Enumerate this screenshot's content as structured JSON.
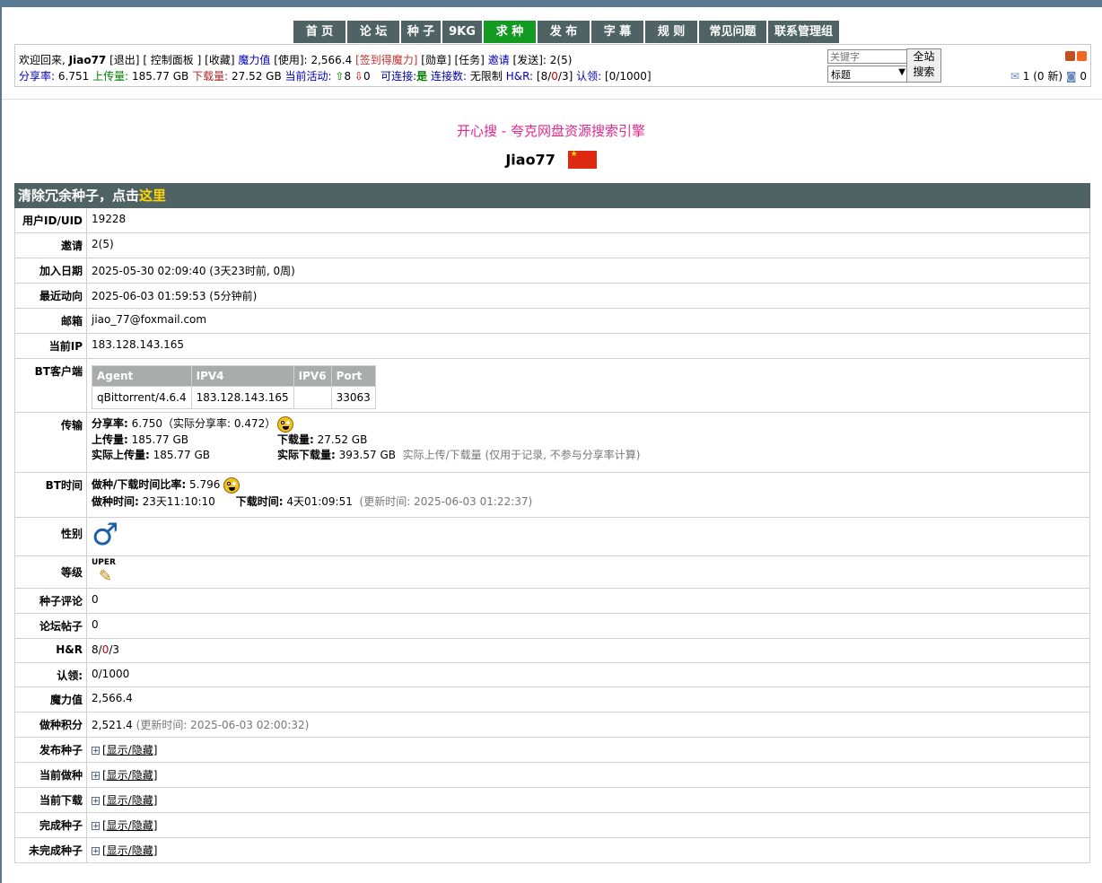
{
  "nav": [
    "首 页",
    "论 坛",
    "种 子",
    "9KG",
    "求 种",
    "发 布",
    "字 幕",
    "规 则",
    "常见问题",
    "联系管理组"
  ],
  "infobar": {
    "welcome": "欢迎回来,",
    "username": "Jiao77",
    "logout": "[退出]",
    "control_panel": "[ 控制面板 ]",
    "bookmarks": "[收藏]",
    "magic_label": "魔力值",
    "use": "[使用]:",
    "magic_value": "2,566.4",
    "checkin": "[签到得魔力]",
    "medals": "[勋章]",
    "tasks": "[任务]",
    "invite_label": "邀请",
    "invite_send": "[发送]:",
    "invite_value": "2(5)",
    "ratio_label": "分享率:",
    "ratio_value": "6.751",
    "upload_label": "上传量:",
    "upload_value": "185.77 GB",
    "download_label": "下载量:",
    "download_value": "27.52 GB",
    "activity_label": "当前活动:",
    "seeding": "8",
    "leeching": "0",
    "connectable_label": "可连接:",
    "connectable_value": "是",
    "connections_label": "连接数:",
    "connections_value": "无限制",
    "hr_label": "H&R:",
    "hr_a": "[8/",
    "hr_b": "0",
    "hr_c": "/3]",
    "claim_label": "认领:",
    "claim_value": "[0/1000]",
    "search_placeholder": "关键字",
    "search_select": "标题",
    "search_btn_1": "全站",
    "search_btn_2": "搜索",
    "messages": "1 (0 新)",
    "messages2": "0"
  },
  "promo": "开心搜 - 夸克网盘资源搜索引擎",
  "profile_name": "Jiao77",
  "banner": {
    "text": "清除冗余种子，点击",
    "link": "这里"
  },
  "rows": {
    "uid_label": "用户ID/UID",
    "uid": "19228",
    "invite_label": "邀请",
    "invite": "2(5)",
    "join_label": "加入日期",
    "join": "2025-05-30 02:09:40 (3天23时前, 0周)",
    "last_label": "最近动向",
    "last": "2025-06-03 01:59:53 (5分钟前)",
    "email_label": "邮箱",
    "email": "jiao_77@foxmail.com",
    "ip_label": "当前IP",
    "ip": "183.128.143.165",
    "bt_label": "BT客户端",
    "transfer_label": "传输",
    "bttime_label": "BT时间",
    "gender_label": "性别",
    "level_label": "等级",
    "comments_label": "种子评论",
    "comments": "0",
    "posts_label": "论坛帖子",
    "posts": "0",
    "hr_label": "H&R",
    "hr_a": "8/",
    "hr_b": "0",
    "hr_c": "/3",
    "claim_label": "认领:",
    "claim": "0/1000",
    "magic_label": "魔力值",
    "magic": "2,566.4",
    "seedpts_label": "做种积分",
    "seedpts": "2,521.4",
    "seedpts_note": "(更新时间: 2025-06-03 02:00:32)",
    "published_label": "发布种子",
    "seeding_label": "当前做种",
    "downloading_label": "当前下载",
    "completed_label": "完成种子",
    "incomplete_label": "未完成种子",
    "toggle": "[显示/隐藏]"
  },
  "bt_client": {
    "headers": [
      "Agent",
      "IPV4",
      "IPV6",
      "Port"
    ],
    "row": [
      "qBittorrent/4.6.4",
      "183.128.143.165",
      "",
      "33063"
    ]
  },
  "transfer": {
    "ratio_label": "分享率:",
    "ratio": "6.750",
    "real_ratio_label": "（实际分享率:",
    "real_ratio": "0.472）",
    "up_label": "上传量:",
    "up": "185.77 GB",
    "down_label": "下载量:",
    "down": "27.52 GB",
    "real_up_label": "实际上传量:",
    "real_up": "185.77 GB",
    "real_down_label": "实际下载量:",
    "real_down": "393.57 GB",
    "note": "实际上传/下载量 (仅用于记录, 不参与分享率计算)"
  },
  "bttime": {
    "ratio_label": "做种/下载时间比率:",
    "ratio": "5.796",
    "seed_label": "做种时间:",
    "seed": "23天11:10:10",
    "dl_label": "下载时间:",
    "dl": "4天01:09:51",
    "updated": "(更新时间: 2025-06-03 01:22:37)"
  },
  "gender_symbol": "♂",
  "level_text": "UPER",
  "colors": {
    "nav_bg": "#4f6365",
    "nav_active": "#139a21",
    "promo": "#e0288c",
    "gender": "#1d5fa8"
  }
}
